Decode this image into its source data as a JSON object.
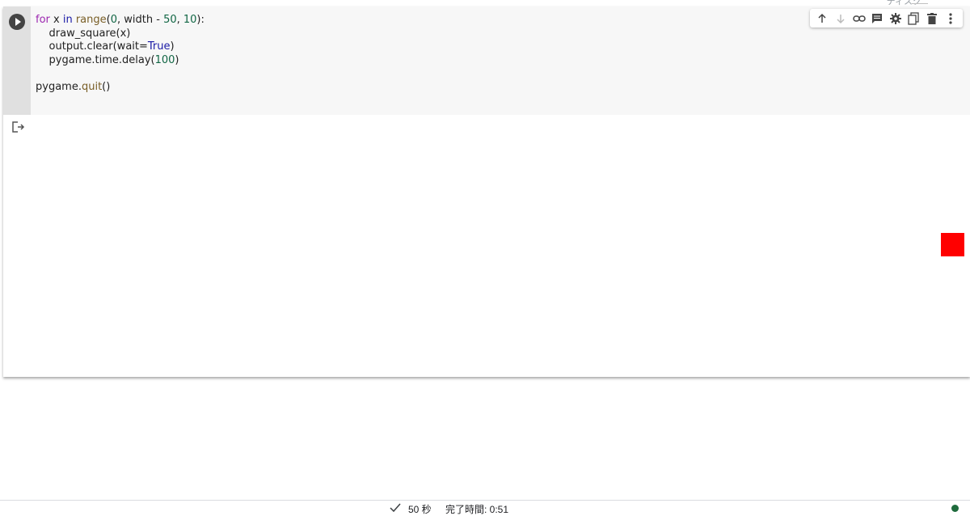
{
  "top_strip": {
    "cutoff_label": "ディスク"
  },
  "cell": {
    "run_button_icon": "play-circle-icon",
    "code_lines": {
      "line1_kw_for": "for",
      "line1_x": " x ",
      "line1_kw_in": "in",
      "line1_range": " range",
      "line1_open": "(",
      "line1_zero": "0",
      "line1_width": ", width - ",
      "line1_fifty": "50",
      "line1_comma": ", ",
      "line1_ten": "10",
      "line1_close": "):",
      "line2": "    draw_square(x)",
      "line3_prefix": "    output.clear(wait=",
      "line3_true": "True",
      "line3_suffix": ")",
      "line4_prefix": "    pygame.time.delay(",
      "line4_num": "100",
      "line4_suffix": ")",
      "line6_prefix": "pygame.",
      "line6_fn": "quit",
      "line6_suffix": "()"
    },
    "toolbar": {
      "icons": [
        "arrow-up-icon",
        "arrow-down-icon",
        "link-icon",
        "comment-icon",
        "gear-icon",
        "mirror-cell-icon",
        "trash-icon",
        "more-vert-icon"
      ]
    }
  },
  "output": {
    "output_icon": "output-exit-icon",
    "square_color": "#ff0000"
  },
  "status_bar": {
    "check_icon": "check-icon",
    "duration": "50 秒",
    "completed": "完了時間: 0:51",
    "connection_color": "#1e6b3c"
  }
}
